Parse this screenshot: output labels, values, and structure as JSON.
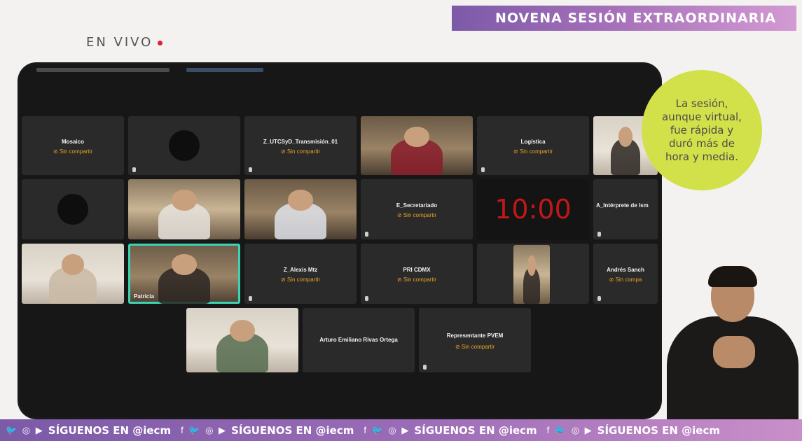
{
  "banner": {
    "title": "NOVENA SESIÓN EXTRAORDINARIA"
  },
  "live": {
    "label": "EN VIVO"
  },
  "callout": {
    "text": "La sesión, aunque virtual, fue rápida y duró más de hora y media."
  },
  "meeting": {
    "participants": {
      "mosaico": {
        "name": "Mosaico",
        "status": "⊘ Sin compartir"
      },
      "utcsyd": {
        "name": "Z_UTCSyD_Transmisión_01",
        "status": "⊘ Sin compartir"
      },
      "logistica": {
        "name": "Logística",
        "status": "⊘ Sin compartir"
      },
      "secretariado": {
        "name": "E_Secretariado",
        "status": "⊘ Sin compartir"
      },
      "interprete": {
        "name": "A_Intérprete de lsm"
      },
      "patricia": {
        "name": "Patricia"
      },
      "alexis": {
        "name": "Z_Alexis Mtz",
        "status": "⊘ Sin compartir"
      },
      "pri": {
        "name": "PRI CDMX",
        "status": "⊘ Sin compartir"
      },
      "andres": {
        "name": "Andrés Sanch",
        "status": "⊘ Sin compa"
      },
      "arturo": {
        "name": "Arturo Emiliano Rivas Ortega"
      },
      "pvem": {
        "name": "Representante PVEM",
        "status": "⊘ Sin compartir"
      }
    },
    "clock": "10:00"
  },
  "footer": {
    "icons": "🐦 ◎ ▶",
    "icons2": "f 🐦 ◎ ▶",
    "follow": "SÍGUENOS EN @iecm"
  },
  "colors": {
    "accent": "#a46fb8",
    "callout": "#d2e04a",
    "status": "#e8a228",
    "clock": "#c01818",
    "active": "#3bd3b0"
  }
}
